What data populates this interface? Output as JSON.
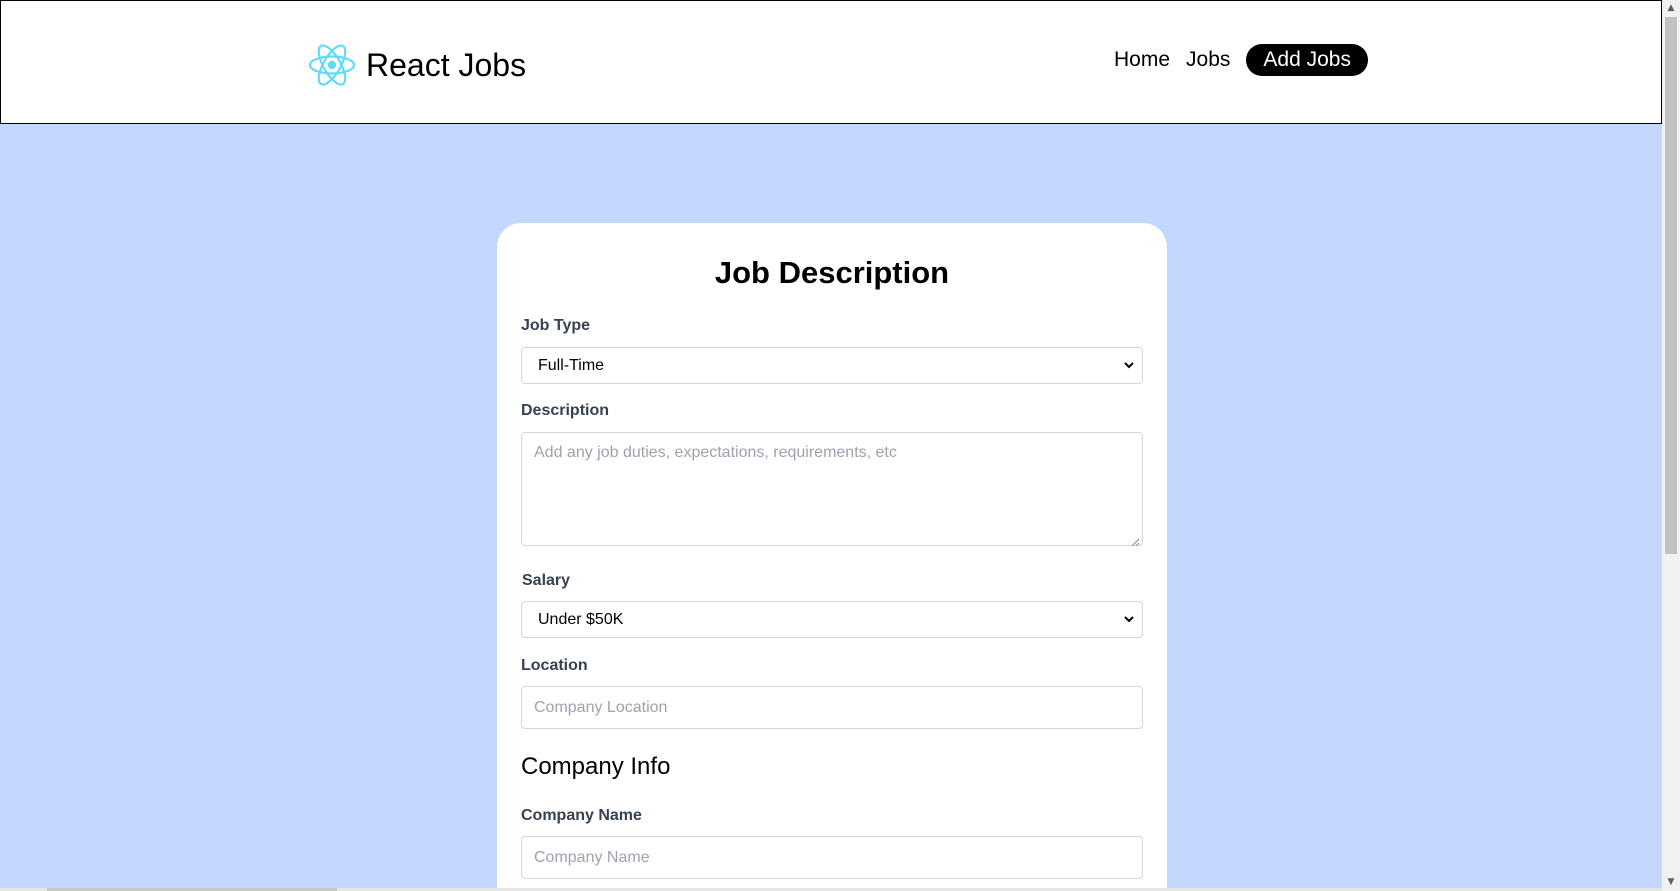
{
  "header": {
    "brand": "React Jobs",
    "nav": {
      "home": "Home",
      "jobs": "Jobs",
      "add_jobs": "Add Jobs"
    }
  },
  "form": {
    "title": "Job Description",
    "job_type": {
      "label": "Job Type",
      "value": "Full-Time"
    },
    "description": {
      "label": "Description",
      "placeholder": "Add any job duties, expectations, requirements, etc"
    },
    "salary": {
      "label": "Salary",
      "value": "Under $50K"
    },
    "location": {
      "label": "Location",
      "placeholder": "Company Location"
    },
    "company_info_heading": "Company Info",
    "company_name": {
      "label": "Company Name",
      "placeholder": "Company Name"
    }
  },
  "colors": {
    "page_background": "#c4d7fd",
    "brand_icon": "#61dafb",
    "active_nav_bg": "#000000"
  }
}
